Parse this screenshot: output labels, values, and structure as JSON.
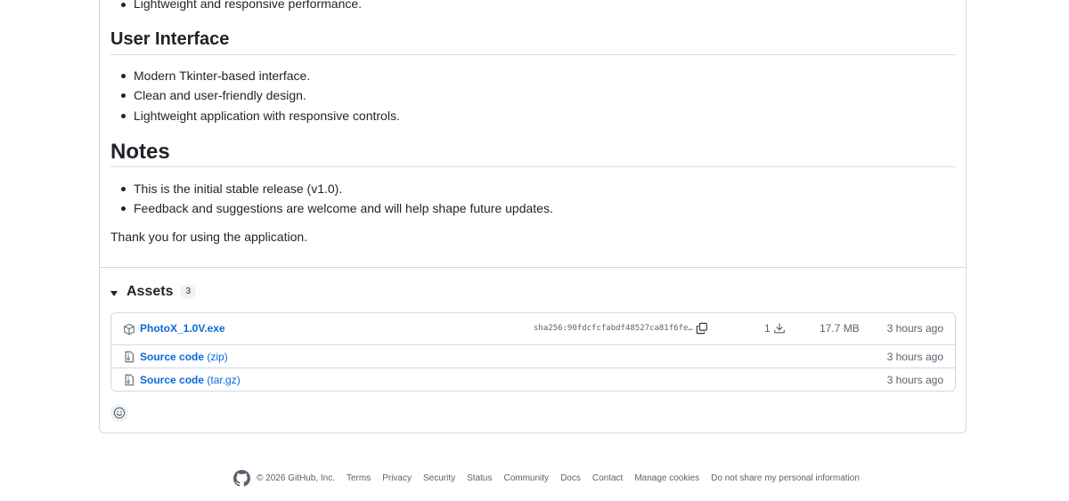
{
  "release_body": {
    "top_bullet": "Lightweight and responsive performance.",
    "ui_section": {
      "heading": "User Interface",
      "items": [
        "Modern Tkinter-based interface.",
        "Clean and user-friendly design.",
        "Lightweight application with responsive controls."
      ]
    },
    "notes_section": {
      "heading": "Notes",
      "items": [
        "This is the initial stable release (v1.0).",
        "Feedback and suggestions are welcome and will help shape future updates."
      ]
    },
    "closing": "Thank you for using the application."
  },
  "assets": {
    "title": "Assets",
    "count": "3",
    "rows": [
      {
        "icon": "package-icon",
        "name": "PhotoX_1.0V.exe",
        "sha": "sha256:90fdcfcfabdf48527ca81f6fe…",
        "downloads": "1",
        "size": "17.7 MB",
        "time": "3 hours ago"
      },
      {
        "icon": "file-zip-icon",
        "name": "Source code",
        "suffix": "(zip)",
        "time": "3 hours ago"
      },
      {
        "icon": "file-zip-icon",
        "name": "Source code",
        "suffix": "(tar.gz)",
        "time": "3 hours ago"
      }
    ]
  },
  "footer": {
    "copyright": "© 2026 GitHub, Inc.",
    "links": [
      "Terms",
      "Privacy",
      "Security",
      "Status",
      "Community",
      "Docs",
      "Contact",
      "Manage cookies",
      "Do not share my personal information"
    ]
  },
  "colors": {
    "link": "#0969da",
    "muted": "#59636e",
    "border": "#d1d9e0",
    "text": "#1f2328"
  }
}
